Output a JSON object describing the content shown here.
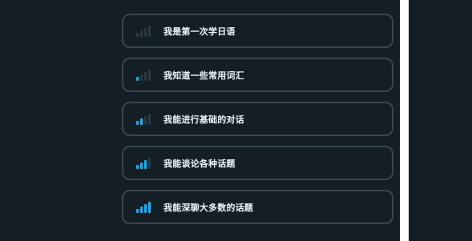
{
  "levels": [
    {
      "label": "我是第一次学日语",
      "signal": 0
    },
    {
      "label": "我知道一些常用词汇",
      "signal": 1
    },
    {
      "label": "我能进行基础的对话",
      "signal": 2
    },
    {
      "label": "我能谈论各种话题",
      "signal": 3
    },
    {
      "label": "我能深聊大多数的话题",
      "signal": 4
    }
  ],
  "colors": {
    "background": "#131f24",
    "border": "#37464f",
    "bar_active": "#1cb0f6",
    "bar_inactive": "#2b3a42",
    "text": "#f1f7fb",
    "divider": "#ffffff"
  },
  "icons": {
    "level": "signal-bars-icon"
  }
}
